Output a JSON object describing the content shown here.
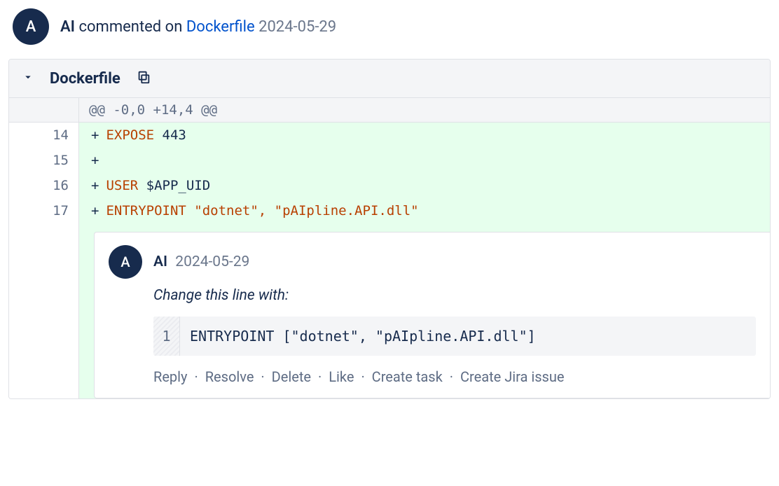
{
  "header": {
    "avatar_initial": "A",
    "author": "AI",
    "verb": "commented on",
    "file_link": "Dockerfile",
    "date": "2024-05-29"
  },
  "file": {
    "name": "Dockerfile",
    "hunk": "@@ -0,0 +14,4 @@",
    "lines": [
      {
        "num": "14",
        "plus": "+",
        "kw": "EXPOSE",
        "rest": " 443"
      },
      {
        "num": "15",
        "plus": "+",
        "kw": "",
        "rest": ""
      },
      {
        "num": "16",
        "plus": "+",
        "kw": "USER",
        "rest": " $APP_UID"
      },
      {
        "num": "17",
        "plus": "+",
        "kw": "ENTRYPOINT",
        "rest": " \"dotnet\", \"pAIpline.API.dll\""
      }
    ]
  },
  "comment": {
    "avatar_initial": "A",
    "author": "AI",
    "date": "2024-05-29",
    "text": "Change this line with:",
    "code_line_num": "1",
    "code": "ENTRYPOINT [\"dotnet\", \"pAIpline.API.dll\"]",
    "actions": [
      "Reply",
      "Resolve",
      "Delete",
      "Like",
      "Create task",
      "Create Jira issue"
    ]
  }
}
